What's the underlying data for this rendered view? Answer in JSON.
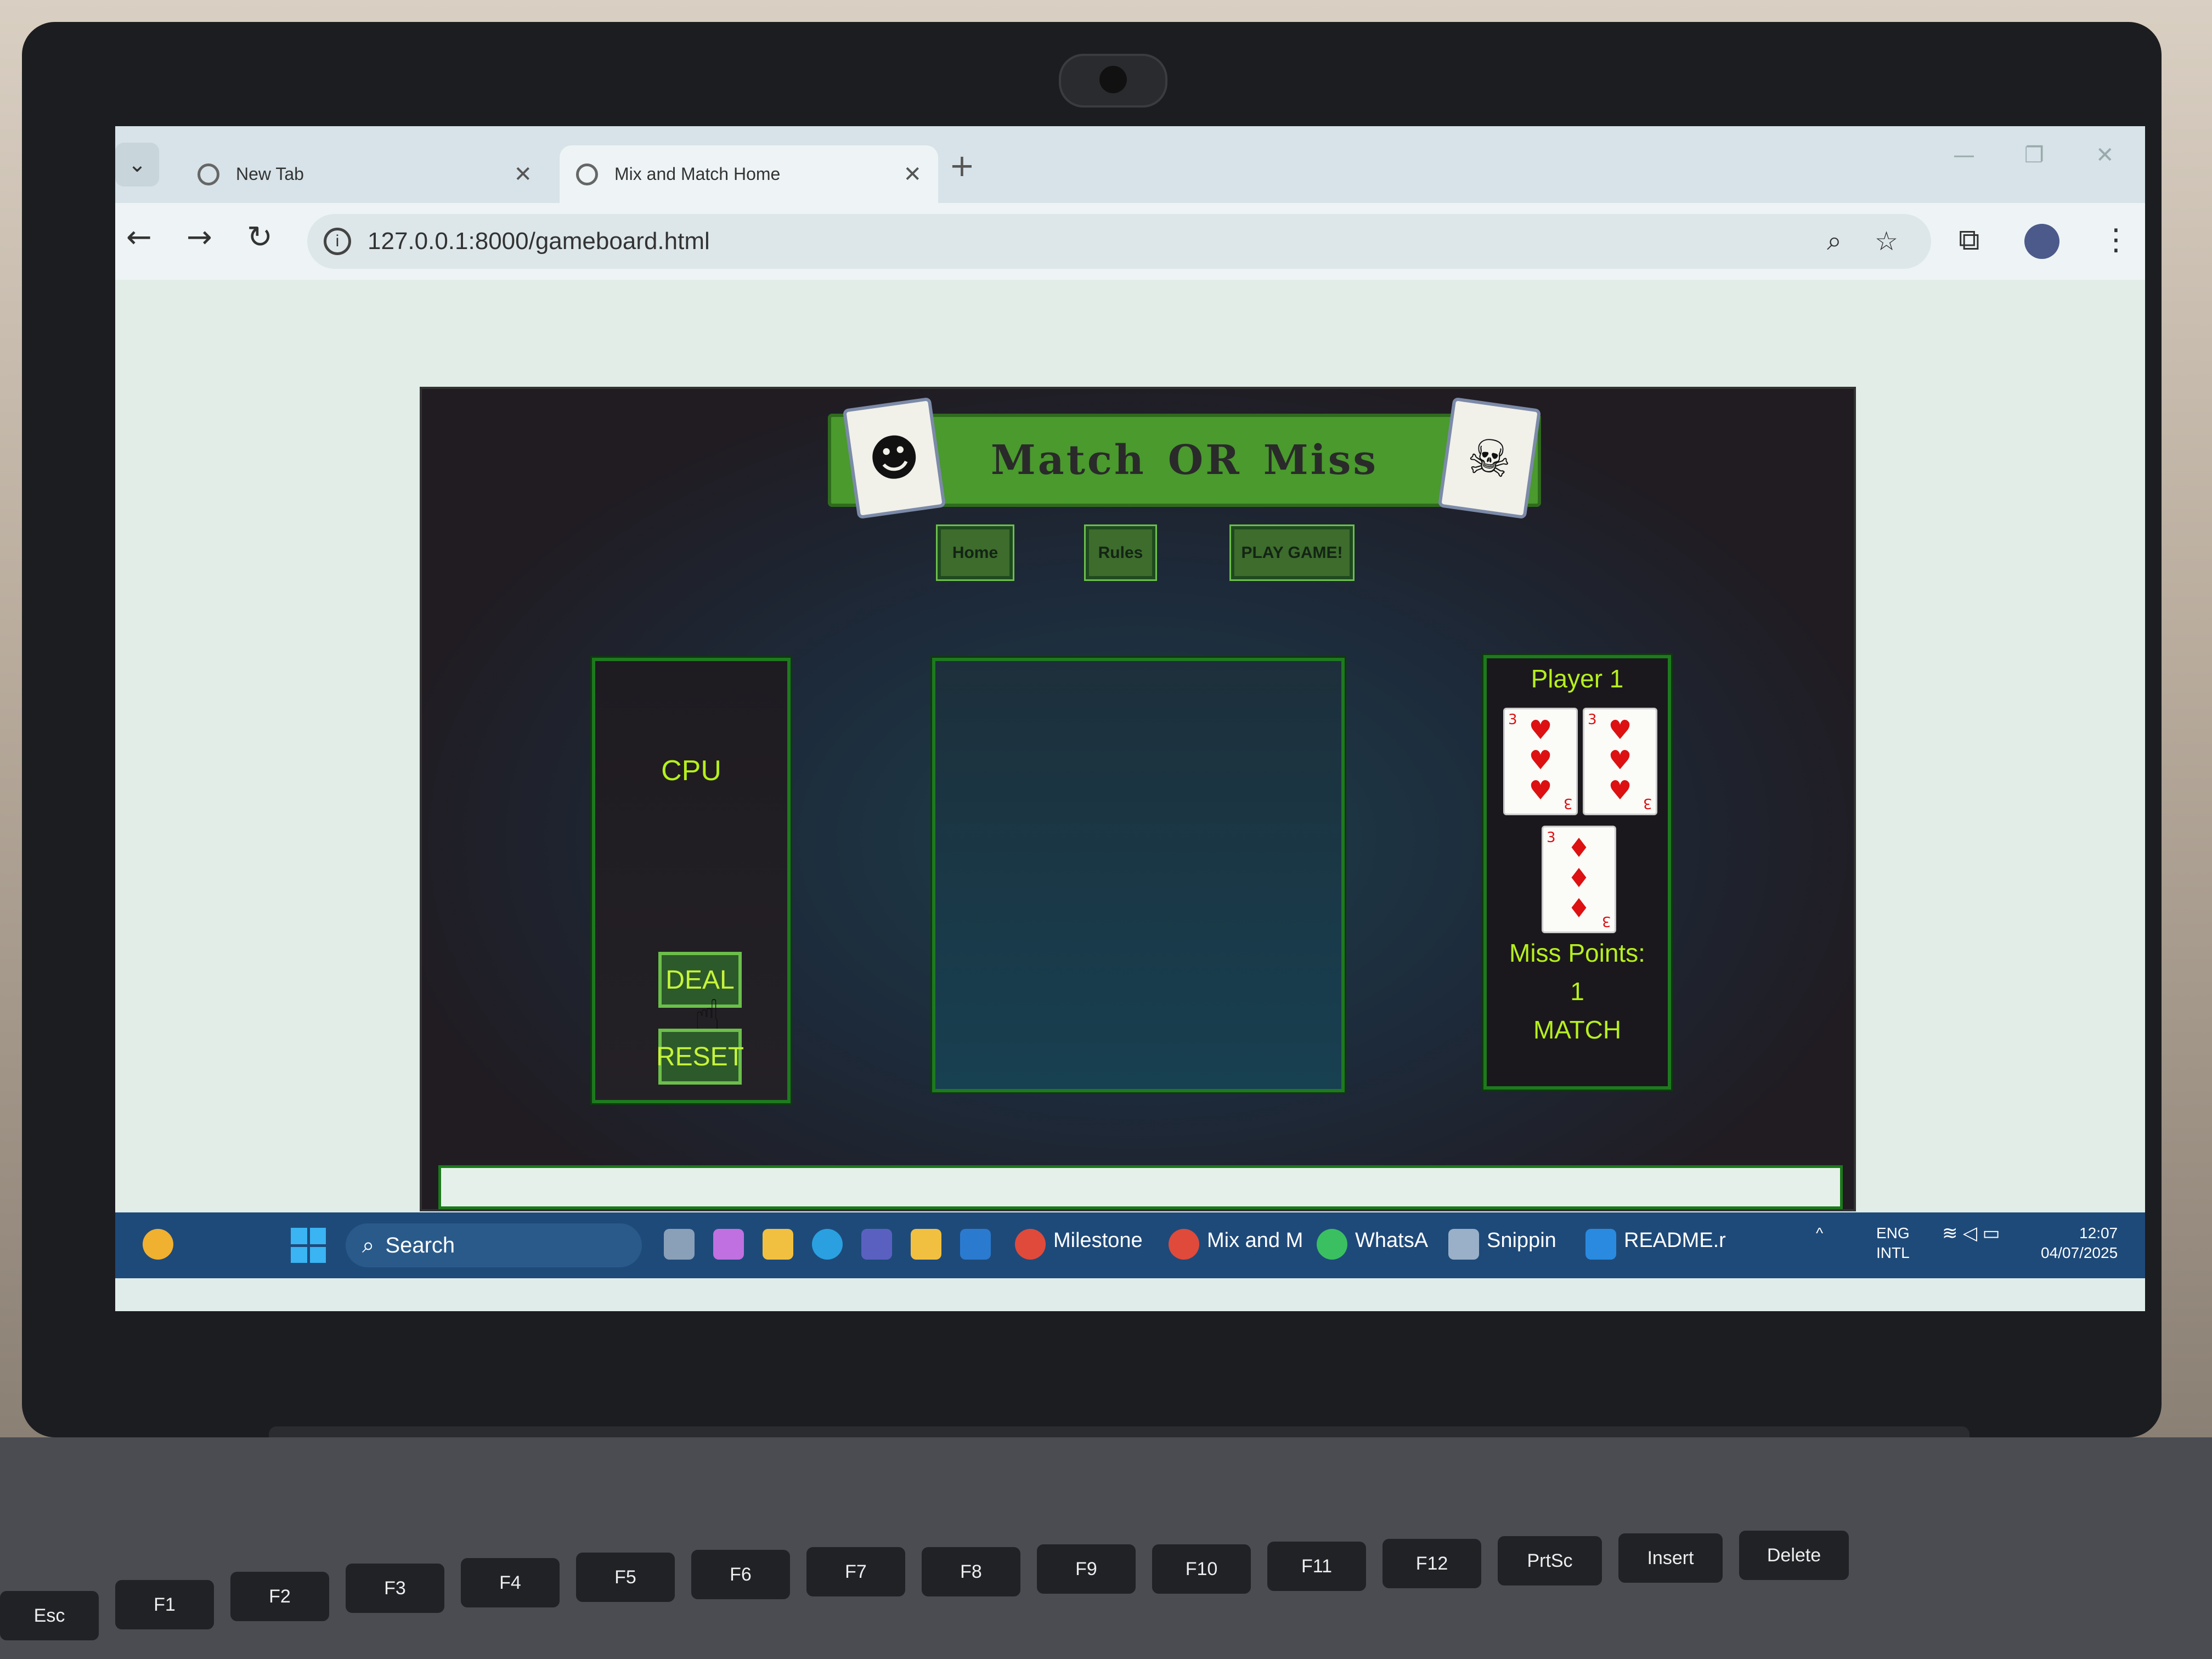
{
  "browser": {
    "tabs": [
      {
        "label": "New Tab"
      },
      {
        "label": "Mix and Match Home"
      }
    ],
    "url": "127.0.0.1:8000/gameboard.html"
  },
  "game": {
    "logo": {
      "word1": "Match",
      "word2": "OR",
      "word3": "Miss"
    },
    "nav": {
      "home": "Home",
      "rules": "Rules",
      "play": "PLAY GAME!"
    },
    "cpu": {
      "title": "CPU",
      "deal": "DEAL",
      "reset": "RESET"
    },
    "player": {
      "title": "Player 1",
      "cards": [
        {
          "rank": "3",
          "suit": "♥"
        },
        {
          "rank": "3",
          "suit": "♥"
        },
        {
          "rank": "3",
          "suit": "♦"
        }
      ],
      "miss_label": "Miss Points:",
      "miss_value": "1",
      "status": "MATCH"
    }
  },
  "taskbar": {
    "search": "Search",
    "apps": [
      {
        "label": "Milestone"
      },
      {
        "label": "Mix and M"
      },
      {
        "label": "WhatsA"
      },
      {
        "label": "Snippin"
      },
      {
        "label": "README.r"
      }
    ],
    "language": "ENG",
    "layout": "INTL",
    "time": "12:07",
    "date": "04/07/2025"
  },
  "keyboard": {
    "keys": [
      "Esc",
      "F1",
      "F2",
      "F3",
      "F4",
      "F5",
      "F6",
      "F7",
      "F8",
      "F9",
      "F10",
      "F11",
      "F12",
      "PrtSc",
      "Insert",
      "Delete"
    ]
  }
}
